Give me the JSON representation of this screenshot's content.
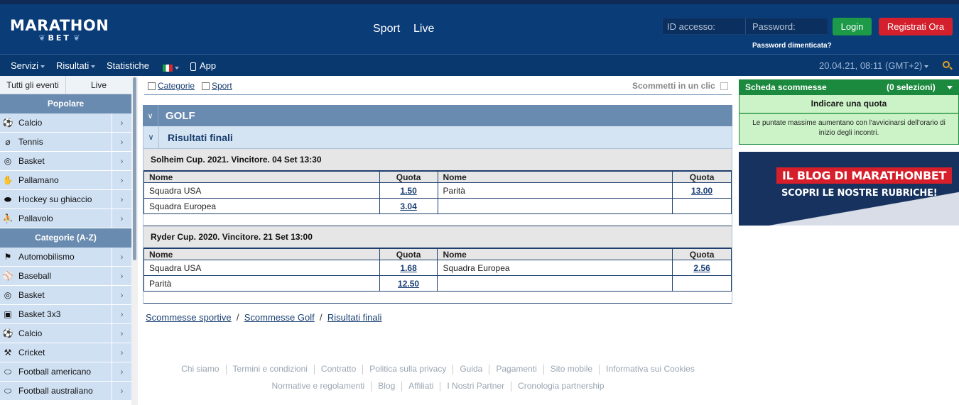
{
  "logo": {
    "line1": "MARATHON",
    "line2": "BET"
  },
  "topnav": {
    "sport": "Sport",
    "live": "Live"
  },
  "login": {
    "id_placeholder": "ID accesso:",
    "password_placeholder": "Password:",
    "login_label": "Login",
    "register_label": "Registrati Ora",
    "forgot_label": "Password dimenticata?"
  },
  "navbar": {
    "servizi": "Servizi",
    "risultati": "Risultati",
    "statistiche": "Statistiche",
    "app": "App",
    "datetime": "20.04.21, 08:11 (GMT+2)"
  },
  "sidebar": {
    "tabs": [
      "Tutti gli eventi",
      "Live"
    ],
    "popular_title": "Popolare",
    "popular": [
      "Calcio",
      "Tennis",
      "Basket",
      "Pallamano",
      "Hockey su ghiaccio",
      "Pallavolo"
    ],
    "categories_title": "Categorie (A-Z)",
    "categories": [
      "Automobilismo",
      "Baseball",
      "Basket",
      "Basket 3x3",
      "Calcio",
      "Cricket",
      "Football americano",
      "Football australiano"
    ]
  },
  "filters": {
    "categorie": "Categorie",
    "sport": "Sport",
    "one_click": "Scommetti in un clic"
  },
  "main": {
    "sport_title": "GOLF",
    "section_title": "Risultati finali",
    "col_name": "Nome",
    "col_odds": "Quota",
    "events": [
      {
        "title": "Solheim Cup. 2021. Vincitore.  04 Set 13:30",
        "rows": [
          {
            "n1": "Squadra USA",
            "q1": "1.50",
            "n2": "Parità",
            "q2": "13.00"
          },
          {
            "n1": "Squadra Europea",
            "q1": "3.04",
            "n2": "",
            "q2": ""
          }
        ]
      },
      {
        "title": "Ryder Cup. 2020. Vincitore.  21 Set 13:00",
        "rows": [
          {
            "n1": "Squadra USA",
            "q1": "1.68",
            "n2": "Squadra Europea",
            "q2": "2.56"
          },
          {
            "n1": "Parità",
            "q1": "12.50",
            "n2": "",
            "q2": ""
          }
        ]
      }
    ]
  },
  "breadcrumbs": [
    "Scommesse sportive",
    "Scommesse Golf",
    "Risultati finali"
  ],
  "footer": {
    "row1": [
      "Chi siamo",
      "Termini e condizioni",
      "Contratto",
      "Politica sulla privacy",
      "Guida",
      "Pagamenti",
      "Sito mobile",
      "Informativa sui Cookies"
    ],
    "row2": [
      "Normative e regolamenti",
      "Blog",
      "Affiliati",
      "I Nostri Partner",
      "Cronologia partnership"
    ]
  },
  "betslip": {
    "title": "Scheda scommesse",
    "count": "(0 selezioni)",
    "prompt": "Indicare una quota",
    "note": "Le puntate massime aumentano con l'avvicinarsi dell'orario di inizio degli incontri."
  },
  "banner": {
    "line1": "IL BLOG DI MARATHONBET",
    "line2": "SCOPRI LE NOSTRE RUBRICHE!"
  },
  "colors": {
    "header": "#0a3c78",
    "accent_green": "#1c8a3e",
    "accent_red": "#d3202c",
    "section": "#6a8bb0"
  },
  "icons": {
    "popular": [
      "soccer-ball-icon",
      "tennis-racket-icon",
      "basketball-icon",
      "handball-icon",
      "hockey-puck-icon",
      "volleyball-icon"
    ],
    "categories": [
      "racing-car-icon",
      "baseball-icon",
      "basketball-icon",
      "basket-3x3-icon",
      "soccer-ball-icon",
      "cricket-bat-icon",
      "american-football-icon",
      "australian-football-icon"
    ]
  }
}
